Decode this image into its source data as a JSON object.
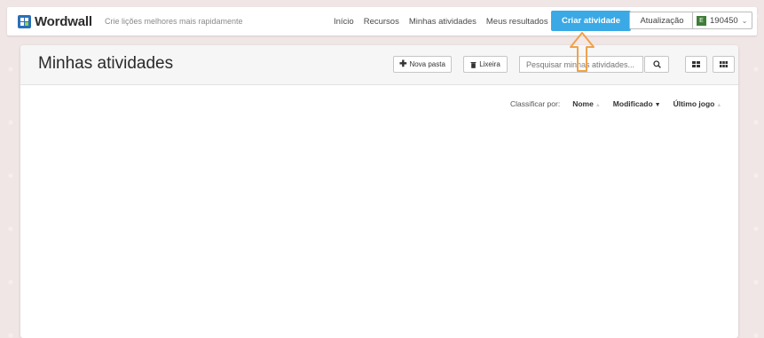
{
  "topbar": {
    "logo_text": "Wordwall",
    "tagline": "Crie lições melhores mais rapidamente",
    "nav": [
      "Início",
      "Recursos",
      "Minhas atividades",
      "Meus resultados"
    ],
    "create_label": "Criar atividade",
    "update_label": "Atualização",
    "account_initial": "E",
    "account_id": "190450"
  },
  "panel": {
    "title": "Minhas atividades",
    "new_folder_label": "Nova pasta",
    "trash_label": "Lixeira",
    "search_placeholder": "Pesquisar minhas atividades..."
  },
  "sort": {
    "label": "Classificar por:",
    "options": [
      "Nome",
      "Modificado",
      "Último jogo"
    ]
  },
  "colors": {
    "accent": "#3aa9e6",
    "arrow": "#f0a14a"
  }
}
